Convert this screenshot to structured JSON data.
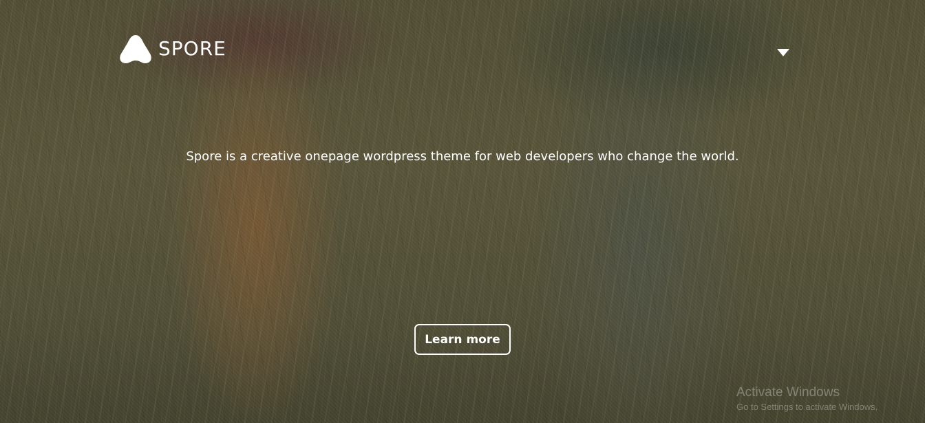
{
  "header": {
    "logo_text": "SPORE",
    "logo_icon": "spore-logo-icon",
    "menu_icon": "caret-down-icon"
  },
  "hero": {
    "tagline": "Spore is a creative onepage wordpress theme for web developers who change the world.",
    "cta_label": "Learn more"
  },
  "watermark": {
    "title": "Activate Windows",
    "subtitle": "Go to Settings to activate Windows."
  },
  "colors": {
    "text": "#ffffff",
    "overlay_tint": "#5e5a3d"
  }
}
